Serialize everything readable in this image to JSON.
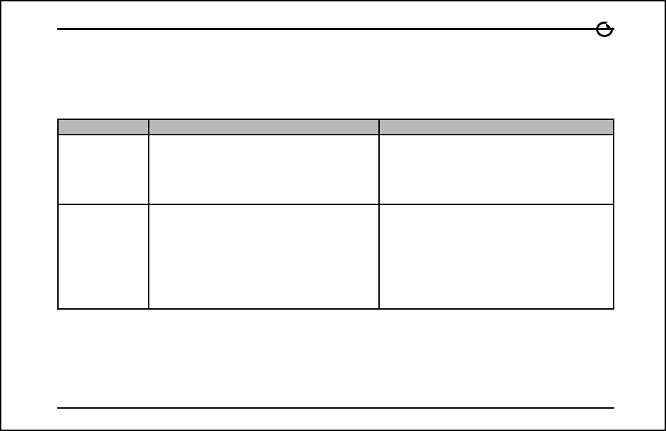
{
  "header": {
    "logo_name": "letter-o-logo"
  },
  "table": {
    "headers": [
      "",
      "",
      ""
    ],
    "rows": [
      {
        "c1": "",
        "c2": "",
        "c3": ""
      },
      {
        "c1": "",
        "c2": "",
        "c3": ""
      }
    ]
  }
}
